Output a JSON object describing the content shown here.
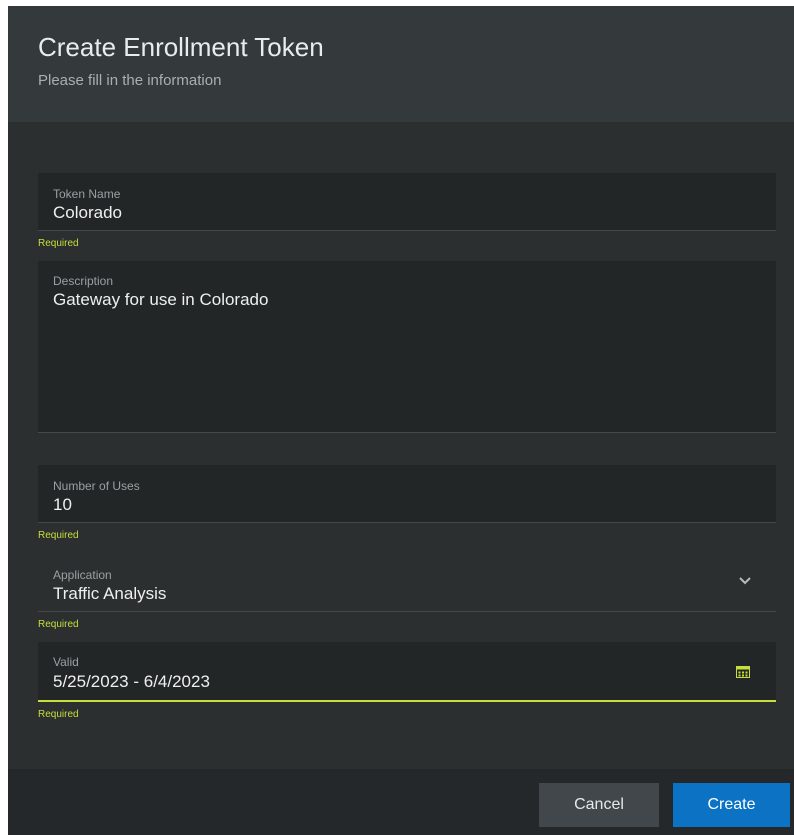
{
  "dialog": {
    "title": "Create Enrollment Token",
    "subtitle": "Please fill in the information"
  },
  "form": {
    "token_name": {
      "label": "Token Name",
      "value": "Colorado",
      "required": "Required"
    },
    "description": {
      "label": "Description",
      "value": "Gateway for use in Colorado"
    },
    "number_of_uses": {
      "label": "Number of Uses",
      "value": "10",
      "required": "Required"
    },
    "application": {
      "label": "Application",
      "value": "Traffic Analysis",
      "required": "Required",
      "icon": "chevron-down-icon"
    },
    "valid": {
      "label": "Valid",
      "value": "5/25/2023 - 6/4/2023",
      "required": "Required",
      "icon": "calendar-icon"
    }
  },
  "footer": {
    "cancel_label": "Cancel",
    "create_label": "Create"
  },
  "colors": {
    "accent": "#c6df3a",
    "primary_button": "#0b72c4",
    "dialog_bg": "#2b2f30",
    "header_bg": "#34393b",
    "field_bg": "#222627"
  }
}
